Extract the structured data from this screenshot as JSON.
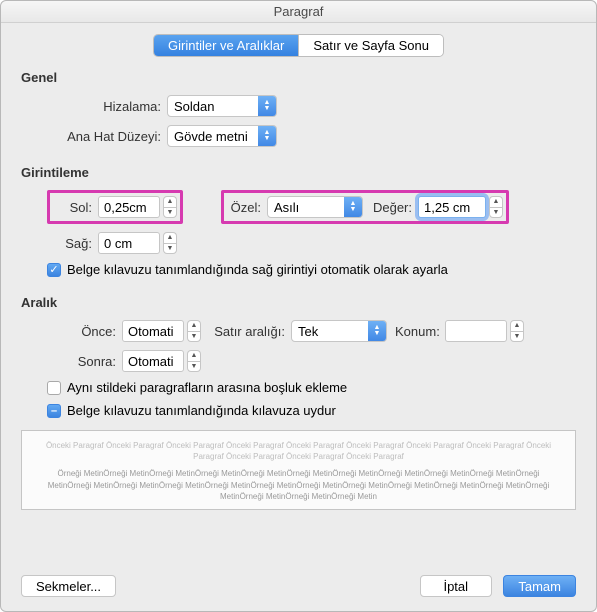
{
  "window": {
    "title": "Paragraf"
  },
  "tabs": {
    "active": "Girintiler ve Aralıklar",
    "inactive": "Satır ve Sayfa Sonu"
  },
  "general": {
    "title": "Genel",
    "alignment_label": "Hizalama:",
    "alignment_value": "Soldan",
    "outline_label": "Ana Hat Düzeyi:",
    "outline_value": "Gövde metni"
  },
  "indent": {
    "title": "Girintileme",
    "left_label": "Sol:",
    "left_value": "0,25cm",
    "right_label": "Sağ:",
    "right_value": "0 cm",
    "special_label": "Özel:",
    "special_value": "Asılı",
    "by_label": "Değer:",
    "by_value": "1,25 cm",
    "auto_checkbox": "Belge kılavuzu tanımlandığında sağ girintiyi otomatik olarak ayarla"
  },
  "spacing": {
    "title": "Aralık",
    "before_label": "Önce:",
    "before_value": "Otomati",
    "after_label": "Sonra:",
    "after_value": "Otomati",
    "line_label": "Satır aralığı:",
    "line_value": "Tek",
    "at_label": "Konum:",
    "at_value": "",
    "no_space_checkbox": "Aynı stildeki paragrafların arasına boşluk ekleme",
    "snap_checkbox": "Belge kılavuzu tanımlandığında kılavuza uydur"
  },
  "preview": {
    "prev": "Önceki Paragraf Önceki Paragraf Önceki Paragraf Önceki Paragraf Önceki Paragraf Önceki Paragraf Önceki Paragraf Önceki Paragraf Önceki Paragraf Önceki Paragraf Önceki Paragraf Önceki Paragraf",
    "sample": "Örneği MetinÖrneği MetinÖrneği MetinÖrneği MetinÖrneği MetinÖrneği MetinÖrneği MetinÖrneği MetinÖrneği MetinÖrneği MetinÖrneği MetinÖrneği MetinÖrneği MetinÖrneği MetinÖrneği MetinÖrneği MetinÖrneği MetinÖrneği MetinÖrneği MetinÖrneği MetinÖrneği MetinÖrneği MetinÖrneği MetinÖrneği MetinÖrneği Metin"
  },
  "footer": {
    "tabs": "Sekmeler...",
    "cancel": "İptal",
    "ok": "Tamam"
  }
}
